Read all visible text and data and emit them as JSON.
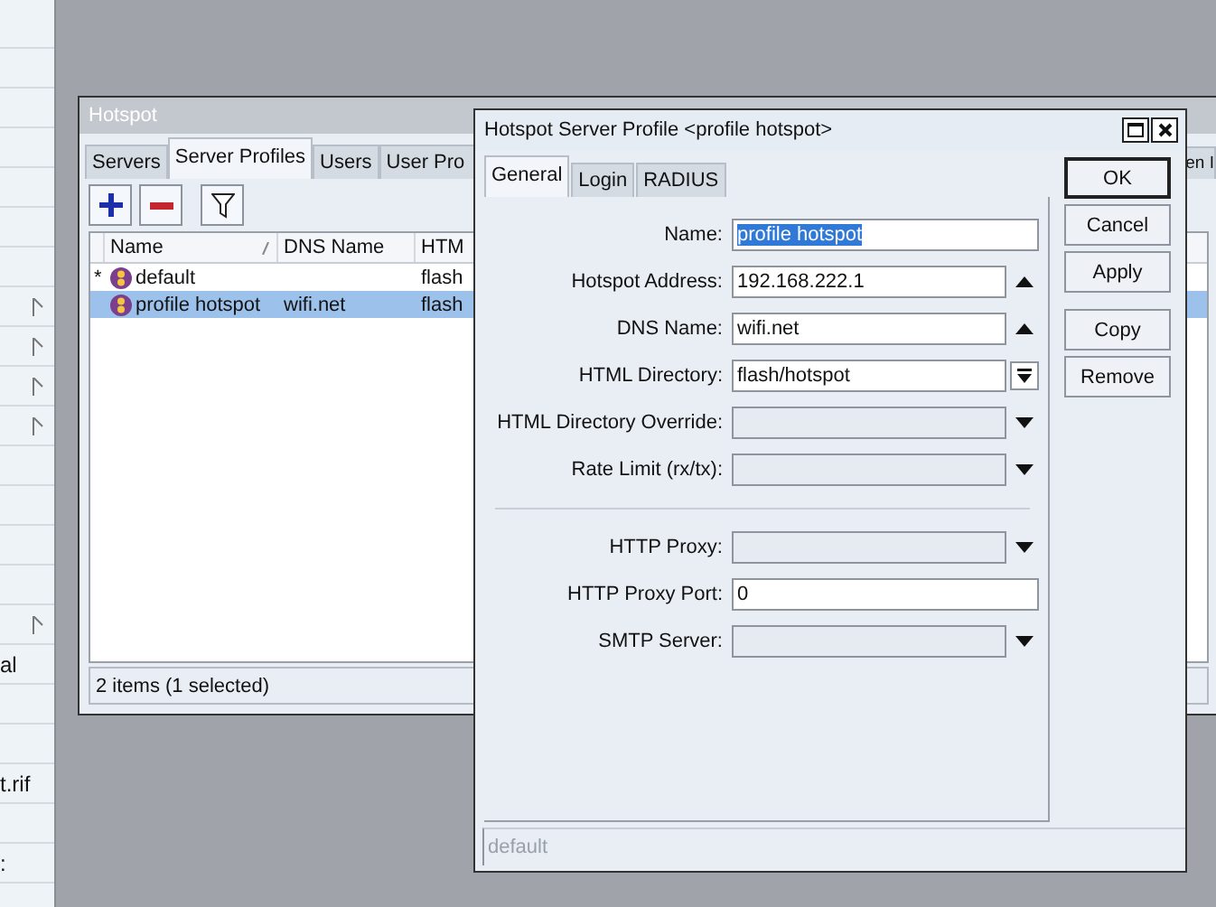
{
  "sidebar": {
    "items": [
      {
        "submenu": false
      },
      {
        "submenu": false
      },
      {
        "submenu": false
      },
      {
        "submenu": false
      },
      {
        "submenu": false
      },
      {
        "submenu": false
      },
      {
        "submenu": false
      },
      {
        "submenu": true
      },
      {
        "submenu": true
      },
      {
        "submenu": true
      },
      {
        "submenu": true
      },
      {
        "submenu": false
      },
      {
        "submenu": false
      },
      {
        "submenu": false
      },
      {
        "submenu": false
      },
      {
        "submenu": true
      },
      {
        "label": "al",
        "submenu": false
      },
      {
        "submenu": false
      },
      {
        "submenu": false
      },
      {
        "label": "t.rif",
        "submenu": false
      },
      {
        "submenu": false
      },
      {
        "label": ":",
        "submenu": false
      }
    ]
  },
  "hotspot_window": {
    "title": "Hotspot",
    "tabs": [
      {
        "label": "Servers",
        "selected": false
      },
      {
        "label": "Server Profiles",
        "selected": true
      },
      {
        "label": "Users",
        "selected": false
      },
      {
        "label": "User Pro",
        "selected": false
      },
      {
        "label": "en I",
        "selected": false
      }
    ],
    "table": {
      "columns": [
        "Name",
        "DNS Name",
        "HTM"
      ],
      "rows": [
        {
          "mark": "*",
          "name": "default",
          "dns_name": "",
          "html": "flash",
          "selected": false
        },
        {
          "mark": "",
          "name": "profile hotspot",
          "dns_name": "wifi.net",
          "html": "flash",
          "selected": true
        }
      ]
    },
    "status_bar": "2 items (1 selected)"
  },
  "profile_dialog": {
    "title": "Hotspot Server Profile <profile hotspot>",
    "tabs": [
      {
        "label": "General",
        "selected": true
      },
      {
        "label": "Login",
        "selected": false
      },
      {
        "label": "RADIUS",
        "selected": false
      }
    ],
    "fields": [
      {
        "label": "Name:",
        "kind": "text",
        "value": "profile hotspot",
        "selected": true
      },
      {
        "label": "Hotspot Address:",
        "kind": "combo_up",
        "value": "192.168.222.1"
      },
      {
        "label": "DNS Name:",
        "kind": "combo_up",
        "value": "wifi.net"
      },
      {
        "label": "HTML Directory:",
        "kind": "combo_menu",
        "value": "flash/hotspot"
      },
      {
        "label": "HTML Directory Override:",
        "kind": "combo_down"
      },
      {
        "label": "Rate Limit (rx/tx):",
        "kind": "combo_down"
      },
      {
        "kind": "separator"
      },
      {
        "label": "HTTP Proxy:",
        "kind": "combo_down"
      },
      {
        "label": "HTTP Proxy Port:",
        "kind": "text",
        "value": "0",
        "selected": false
      },
      {
        "label": "SMTP Server:",
        "kind": "combo_down"
      }
    ],
    "buttons": [
      {
        "label": "OK",
        "default": true
      },
      {
        "label": "Cancel",
        "default": false
      },
      {
        "label": "Apply",
        "default": false
      }
    ],
    "item_buttons": [
      {
        "label": "Copy",
        "default": false
      },
      {
        "label": "Remove",
        "default": false
      }
    ],
    "status_bar": "default"
  }
}
